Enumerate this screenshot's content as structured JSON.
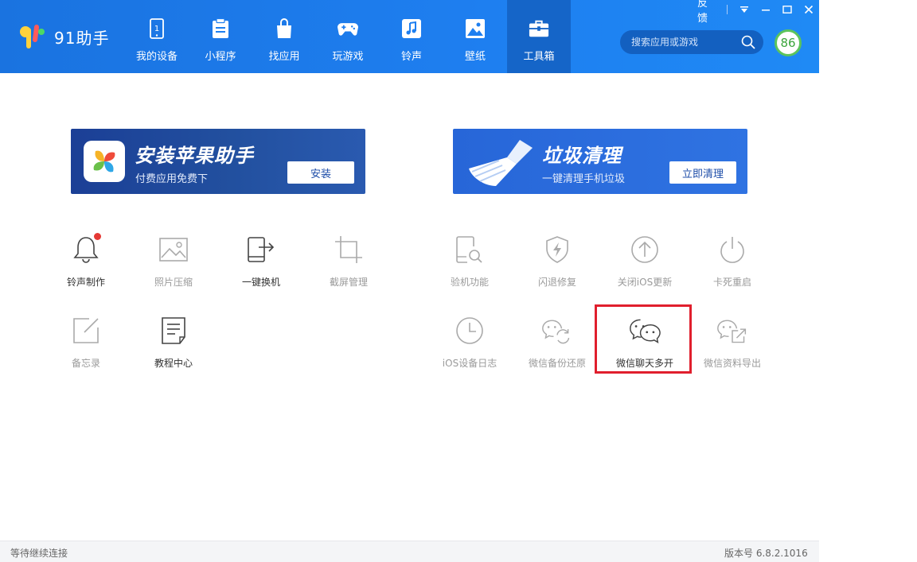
{
  "app": {
    "name": "91助手"
  },
  "window": {
    "feedback": "反馈"
  },
  "nav": {
    "items": [
      {
        "label": "我的设备"
      },
      {
        "label": "小程序"
      },
      {
        "label": "找应用"
      },
      {
        "label": "玩游戏"
      },
      {
        "label": "铃声"
      },
      {
        "label": "壁纸"
      },
      {
        "label": "工具箱"
      }
    ],
    "active_index": 6
  },
  "search": {
    "placeholder": "搜索应用或游戏"
  },
  "score": "86",
  "banners": {
    "install": {
      "title": "安装苹果助手",
      "subtitle": "付费应用免费下",
      "button": "安装"
    },
    "clean": {
      "title": "垃圾清理",
      "subtitle": "一键清理手机垃圾",
      "button": "立即清理"
    }
  },
  "tools": {
    "ringtone": "铃声制作",
    "photo_compress": "照片压缩",
    "phone_switch": "一键换机",
    "screenshot": "截屏管理",
    "memo": "备忘录",
    "tutorial": "教程中心",
    "verify": "验机功能",
    "crash_fix": "闪退修复",
    "disable_update": "关闭iOS更新",
    "force_restart": "卡死重启",
    "ios_log": "iOS设备日志",
    "wechat_backup": "微信备份还原",
    "wechat_multi": "微信聊天多开",
    "wechat_export": "微信资料导出"
  },
  "status": {
    "left": "等待继续连接",
    "version": "版本号 6.8.2.1016"
  },
  "colors": {
    "header": "#1e7ff0",
    "active_tab": "#1565c8",
    "highlight": "#e01f2d",
    "badge": "#e53935"
  }
}
